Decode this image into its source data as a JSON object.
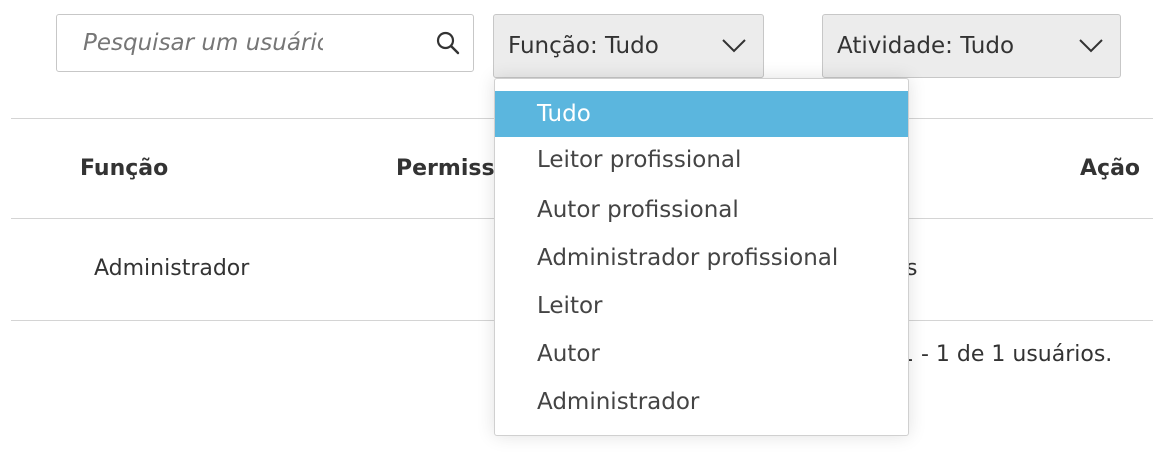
{
  "search": {
    "placeholder": "Pesquisar um usuário"
  },
  "filters": {
    "funcao_label": "Função: Tudo",
    "atividade_label": "Atividade: Tudo"
  },
  "table": {
    "headers": [
      "Função",
      "Permiss",
      "Ação"
    ],
    "rows": [
      {
        "funcao": "Administrador",
        "partial": "s"
      }
    ]
  },
  "pagination": {
    "text": "1 - 1 de 1 usuários."
  },
  "funcao_menu": {
    "selected_index": 0,
    "options": [
      "Tudo",
      "Leitor profissional",
      "Autor profissional",
      "Administrador profissional",
      "Leitor",
      "Autor",
      "Administrador"
    ]
  },
  "colors": {
    "selected_bg": "#5bb6de",
    "dropdown_bg": "#ececec",
    "border": "#c7c7c7",
    "text": "#333333"
  },
  "icons": {
    "search": "search-icon",
    "chevron": "chevron-down-icon"
  }
}
